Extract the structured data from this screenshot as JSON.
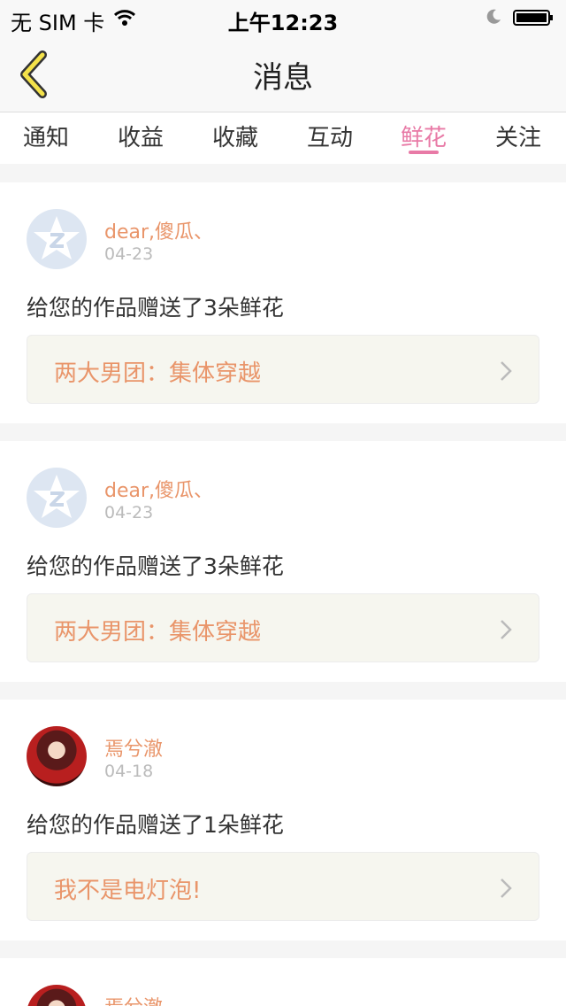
{
  "status_bar": {
    "carrier": "无 SIM 卡",
    "time": "上午12:23",
    "icons": [
      "wifi-icon",
      "moon-icon",
      "battery-icon"
    ]
  },
  "nav": {
    "title": "消息",
    "back_icon": "chevron-left-icon"
  },
  "tabs": [
    {
      "label": "通知"
    },
    {
      "label": "收益"
    },
    {
      "label": "收藏"
    },
    {
      "label": "互动"
    },
    {
      "label": "鲜花",
      "active": true
    },
    {
      "label": "关注"
    }
  ],
  "colors": {
    "accent_pink": "#e87aa6",
    "name_orange": "#e9956a",
    "back_icon_yellow": "#f4e24a"
  },
  "messages": [
    {
      "user": "dear,傻瓜、",
      "date": "04-23",
      "text": "给您的作品赠送了3朵鲜花",
      "work": "两大男团：集体穿越",
      "avatar": "default-avatar"
    },
    {
      "user": "dear,傻瓜、",
      "date": "04-23",
      "text": "给您的作品赠送了3朵鲜花",
      "work": "两大男团：集体穿越",
      "avatar": "default-avatar"
    },
    {
      "user": "焉兮澈",
      "date": "04-18",
      "text": "给您的作品赠送了1朵鲜花",
      "work": "我不是电灯泡!",
      "avatar": "photo-avatar"
    },
    {
      "user": "焉兮澈",
      "avatar": "photo-avatar"
    }
  ]
}
